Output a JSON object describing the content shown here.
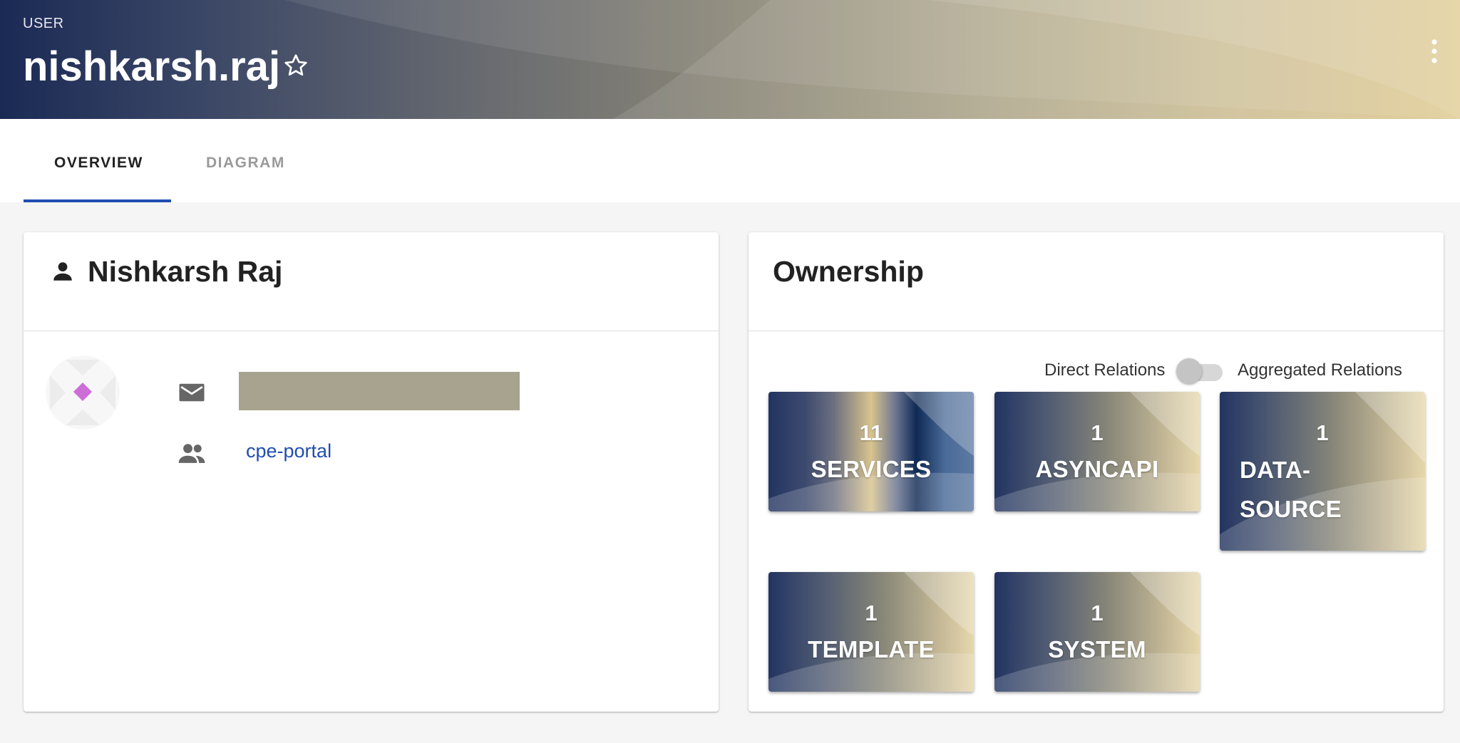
{
  "header": {
    "kind": "USER",
    "title": "nishkarsh.raj",
    "star_icon": "star-outline-icon",
    "more_icon": "more-vertical-icon"
  },
  "tabs": [
    {
      "label": "OVERVIEW",
      "active": true
    },
    {
      "label": "DIAGRAM",
      "active": false
    }
  ],
  "profile": {
    "icon": "person-icon",
    "name": "Nishkarsh Raj",
    "email_icon": "email-icon",
    "group_icon": "group-icon",
    "group": "cpe-portal"
  },
  "ownership": {
    "title": "Ownership",
    "toggle": {
      "left_label": "Direct Relations",
      "right_label": "Aggregated Relations",
      "checked": false
    },
    "tiles": [
      {
        "count": "11",
        "label": "SERVICES"
      },
      {
        "count": "1",
        "label": "ASYNCAPI"
      },
      {
        "count": "1",
        "label_line1": "DATA-",
        "label_line2": "SOURCE"
      },
      {
        "count": "1",
        "label": "TEMPLATE"
      },
      {
        "count": "1",
        "label": "SYSTEM"
      }
    ]
  },
  "colors": {
    "accent": "#1f4eb0",
    "header_start": "#1b2a55",
    "header_end": "#dfc98f"
  }
}
